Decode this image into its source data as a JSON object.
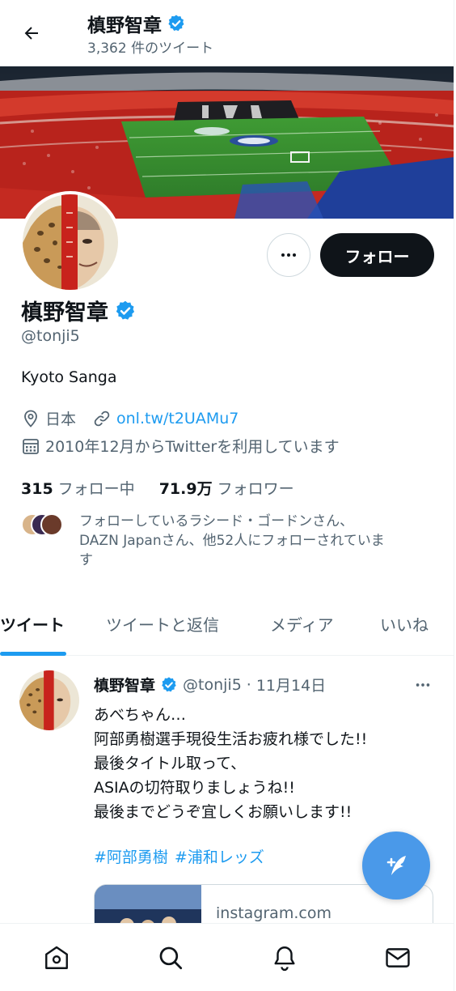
{
  "header": {
    "name": "槙野智章",
    "tweet_count": "3,362 件のツイート"
  },
  "profile": {
    "name": "槙野智章",
    "handle": "@tonji5",
    "bio": "Kyoto Sanga",
    "location": "日本",
    "link": "onl.tw/t2UAMu7",
    "joined": "2010年12月からTwitterを利用しています",
    "following_count": "315",
    "following_label": "フォロー中",
    "followers_count": "71.9万",
    "followers_label": "フォロワー",
    "followed_by_line1": "フォローしているラシード・ゴードンさん、",
    "followed_by_line2": "DAZN Japanさん、他52人にフォローされていま",
    "followed_by_line3": "す"
  },
  "actions": {
    "follow_label": "フォロー"
  },
  "tabs": [
    {
      "label": "ツイート",
      "active": true
    },
    {
      "label": "ツイートと返信",
      "active": false
    },
    {
      "label": "メディア",
      "active": false
    },
    {
      "label": "いいね",
      "active": false
    }
  ],
  "tweet": {
    "name": "槙野智章",
    "handle": "@tonji5",
    "separator": "·",
    "date": "11月14日",
    "lines": [
      "あべちゃん…",
      "阿部勇樹選手現役生活お疲れ様でした!!",
      "最後タイトル取って、",
      "ASIAの切符取りましょうね!!",
      "最後までどうぞ宜しくお願いします!!"
    ],
    "hashtags": [
      "#阿部勇樹",
      "#浦和レッズ"
    ],
    "card_domain": "instagram.com"
  },
  "icons": {
    "back": "arrow-left-icon",
    "verified": "verified-badge-icon",
    "more": "more-horizontal-icon",
    "location": "location-pin-icon",
    "link": "link-icon",
    "calendar": "calendar-icon",
    "compose": "compose-tweet-icon",
    "home": "home-icon",
    "search": "search-icon",
    "notifications": "bell-icon",
    "messages": "envelope-icon"
  },
  "colors": {
    "accent": "#1d9bf0",
    "fab": "#4a99e9",
    "text": "#0f1419",
    "muted": "#536471",
    "follow_button": "#0f1419"
  }
}
